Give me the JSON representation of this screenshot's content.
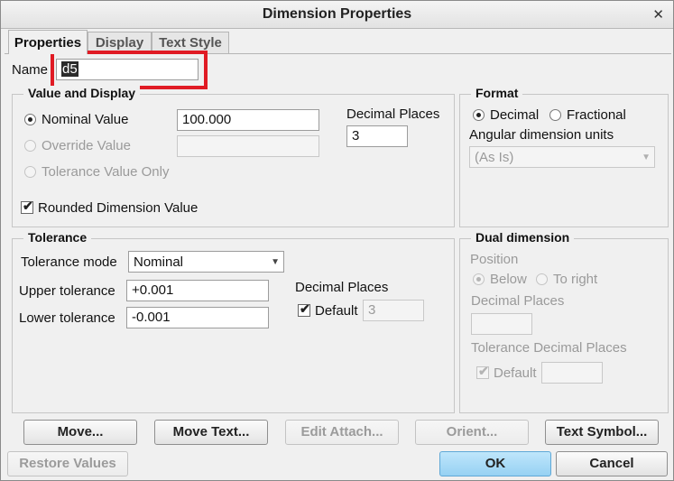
{
  "window": {
    "title": "Dimension Properties",
    "close_glyph": "✕"
  },
  "tabs": [
    {
      "label": "Properties",
      "active": true
    },
    {
      "label": "Display",
      "active": false
    },
    {
      "label": "Text Style",
      "active": false
    }
  ],
  "name": {
    "label": "Name",
    "value": "d5"
  },
  "value_display": {
    "title": "Value and Display",
    "nominal_label": "Nominal Value",
    "nominal_value": "100.000",
    "override_label": "Override Value",
    "override_value": "",
    "tolerance_only_label": "Tolerance Value Only",
    "decimal_places_label": "Decimal Places",
    "decimal_places_value": "3",
    "rounded_label": "Rounded Dimension Value"
  },
  "format": {
    "title": "Format",
    "decimal_label": "Decimal",
    "fractional_label": "Fractional",
    "angular_label": "Angular dimension units",
    "angular_value": "(As Is)"
  },
  "tolerance": {
    "title": "Tolerance",
    "mode_label": "Tolerance mode",
    "mode_value": "Nominal",
    "upper_label": "Upper tolerance",
    "upper_value": "+0.001",
    "lower_label": "Lower tolerance",
    "lower_value": "-0.001",
    "decimal_places_label": "Decimal Places",
    "default_label": "Default",
    "default_value": "3"
  },
  "dual": {
    "title": "Dual dimension",
    "position_label": "Position",
    "below_label": "Below",
    "to_right_label": "To right",
    "decimal_places_label": "Decimal Places",
    "decimal_places_value": "",
    "tol_decimal_label": "Tolerance Decimal Places",
    "default_label": "Default",
    "default_value": ""
  },
  "buttons": {
    "move": "Move...",
    "move_text": "Move Text...",
    "edit_attach": "Edit Attach...",
    "orient": "Orient...",
    "text_symbol": "Text Symbol...",
    "restore": "Restore Values",
    "ok": "OK",
    "cancel": "Cancel"
  },
  "icons": {
    "check": "✔",
    "dropdown": "▼"
  }
}
